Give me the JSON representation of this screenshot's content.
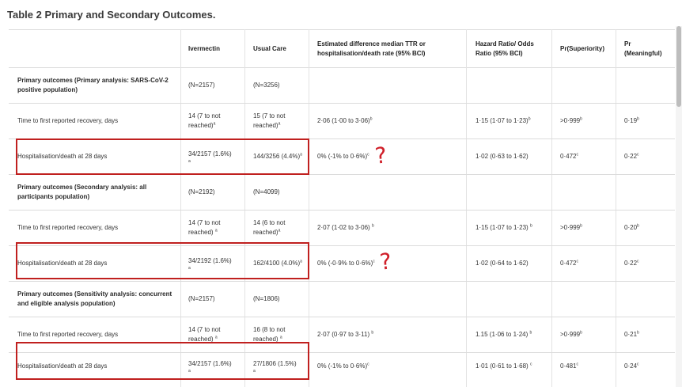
{
  "title": "Table 2  Primary and Secondary Outcomes.",
  "headers": [
    "",
    "Ivermectin",
    "Usual Care",
    "Estimated difference median TTR or hospitalisation/death rate (95% BCI)",
    "Hazard Ratio/ Odds Ratio (95% BCI)",
    "Pr(Superiority)",
    "Pr (Meaningful)"
  ],
  "sections": [
    {
      "label": "Primary outcomes (Primary analysis: SARS-CoV-2 positive population)",
      "n_iver": "(N=2157)",
      "n_usual": "(N=3256)",
      "rows": [
        {
          "label": "Time to first reported recovery, days",
          "iver": "14 (7 to not reached)",
          "iver_sup": "a",
          "usual": "15 (7 to not reached)",
          "usual_sup": "a",
          "diff": "2·06 (1·00 to 3·06)",
          "diff_sup": "b",
          "hr": "1·15 (1·07 to 1·23)",
          "hr_sup": "b",
          "sup": ">0·999",
          "sup_sup": "b",
          "mean": "0·19",
          "mean_sup": "b"
        },
        {
          "label": "Hospitalisation/death at 28 days",
          "iver": "34/2157 (1.6%)",
          "iver_sup": "a",
          "usual": "144/3256 (4.4%)",
          "usual_sup": "a",
          "diff": "0% (-1% to 0·6%)",
          "diff_sup": "c",
          "hr": "1·02 (0·63 to 1·62)",
          "hr_sup": "",
          "sup": "0·472",
          "sup_sup": "c",
          "mean": "0·22",
          "mean_sup": "c"
        }
      ]
    },
    {
      "label": "Primary outcomes (Secondary analysis: all participants population)",
      "n_iver": "(N=2192)",
      "n_usual": "(N=4099)",
      "rows": [
        {
          "label": "Time to first reported recovery, days",
          "iver": "14 (7 to not reached)",
          "iver_sup": "a",
          "usual": "14 (6 to not reached)",
          "usual_sup": "a",
          "diff": "2·07 (1·02 to 3·06)",
          "diff_sup": "b",
          "hr": "1·15 (1·07 to 1·23)",
          "hr_sup": "b",
          "sup": ">0·999",
          "sup_sup": "b",
          "mean": "0·20",
          "mean_sup": "b"
        },
        {
          "label": "Hospitalisation/death at 28 days",
          "iver": "34/2192 (1.6%)",
          "iver_sup": "a",
          "usual": "162/4100 (4.0%)",
          "usual_sup": "a",
          "diff": "0% (-0·9% to 0·6%)",
          "diff_sup": "c",
          "hr": "1·02 (0·64 to 1·62)",
          "hr_sup": "",
          "sup": "0·472",
          "sup_sup": "c",
          "mean": "0·22",
          "mean_sup": "c"
        }
      ]
    },
    {
      "label": "Primary outcomes (Sensitivity analysis: concurrent and eligible analysis population)",
      "n_iver": "(N=2157)",
      "n_usual": "(N=1806)",
      "rows": [
        {
          "label": "Time to first reported recovery, days",
          "iver": "14 (7 to not reached)",
          "iver_sup": "a",
          "usual": "16 (8 to not reached)",
          "usual_sup": "a",
          "diff": "2·07 (0·97 to 3·11)",
          "diff_sup": "b",
          "hr": "1.15 (1·06 to 1·24)",
          "hr_sup": "b",
          "sup": ">0·999",
          "sup_sup": "b",
          "mean": "0·21",
          "mean_sup": "b"
        },
        {
          "label": "Hospitalisation/death at 28 days",
          "iver": "34/2157 (1.6%)",
          "iver_sup": "a",
          "usual": "27/1806 (1.5%)",
          "usual_sup": "a",
          "diff": "0% (-1% to 0·6%)",
          "diff_sup": "c",
          "hr": "1·01 (0·61 to 1·68)",
          "hr_sup": "c",
          "sup": "0·481",
          "sup_sup": "c",
          "mean": "0·24",
          "mean_sup": "c"
        }
      ]
    }
  ],
  "annotations": {
    "qmark_1": "?",
    "qmark_2": "?",
    "color": "#c0201f"
  }
}
